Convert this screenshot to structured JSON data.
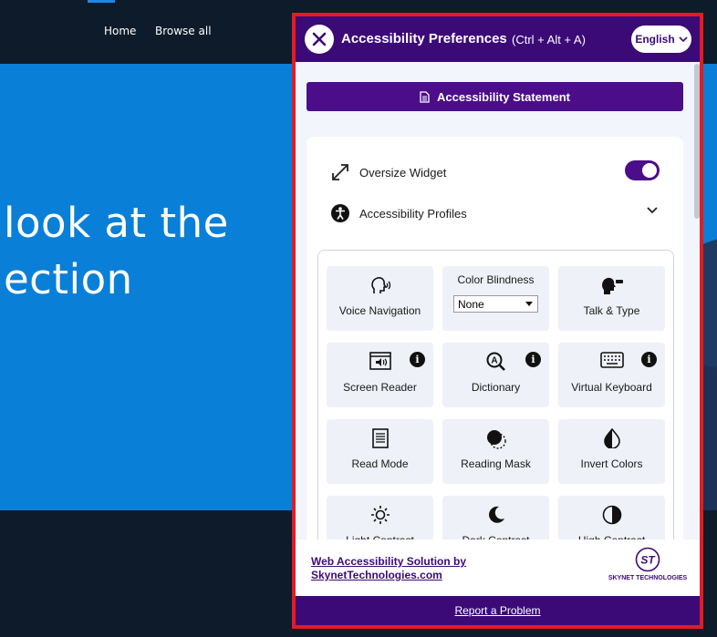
{
  "site": {
    "nav": [
      "Home",
      "Browse all"
    ],
    "hero_lines": [
      "look at the",
      "ection"
    ]
  },
  "widget": {
    "title": "Accessibility Preferences",
    "shortcut": "(Ctrl + Alt + A)",
    "language": "English",
    "statement_label": "Accessibility Statement",
    "oversize_label": "Oversize Widget",
    "oversize_on": true,
    "profiles_label": "Accessibility Profiles",
    "tiles": {
      "voice_navigation": "Voice Navigation",
      "color_blindness": "Color Blindness",
      "color_blindness_value": "None",
      "talk_type": "Talk & Type",
      "screen_reader": "Screen Reader",
      "dictionary": "Dictionary",
      "virtual_keyboard": "Virtual Keyboard",
      "read_mode": "Read Mode",
      "reading_mask": "Reading Mask",
      "invert_colors": "Invert Colors",
      "light_contrast": "Light Contrast",
      "dark_contrast": "Dark Contrast",
      "high_contrast": "High Contrast"
    },
    "info_glyph": "i",
    "footer_link_line1": "Web Accessibility Solution by",
    "footer_link_line2": "SkynetTechnologies.com",
    "logo_text": "SKYNET TECHNOLOGIES",
    "logo_mark": "ST",
    "report_label": "Report a Problem",
    "colors": {
      "purple": "#3b0a77",
      "button_purple": "#4b0d8a",
      "border_red": "#e31b23",
      "hero_blue": "#0a7fd8"
    }
  }
}
